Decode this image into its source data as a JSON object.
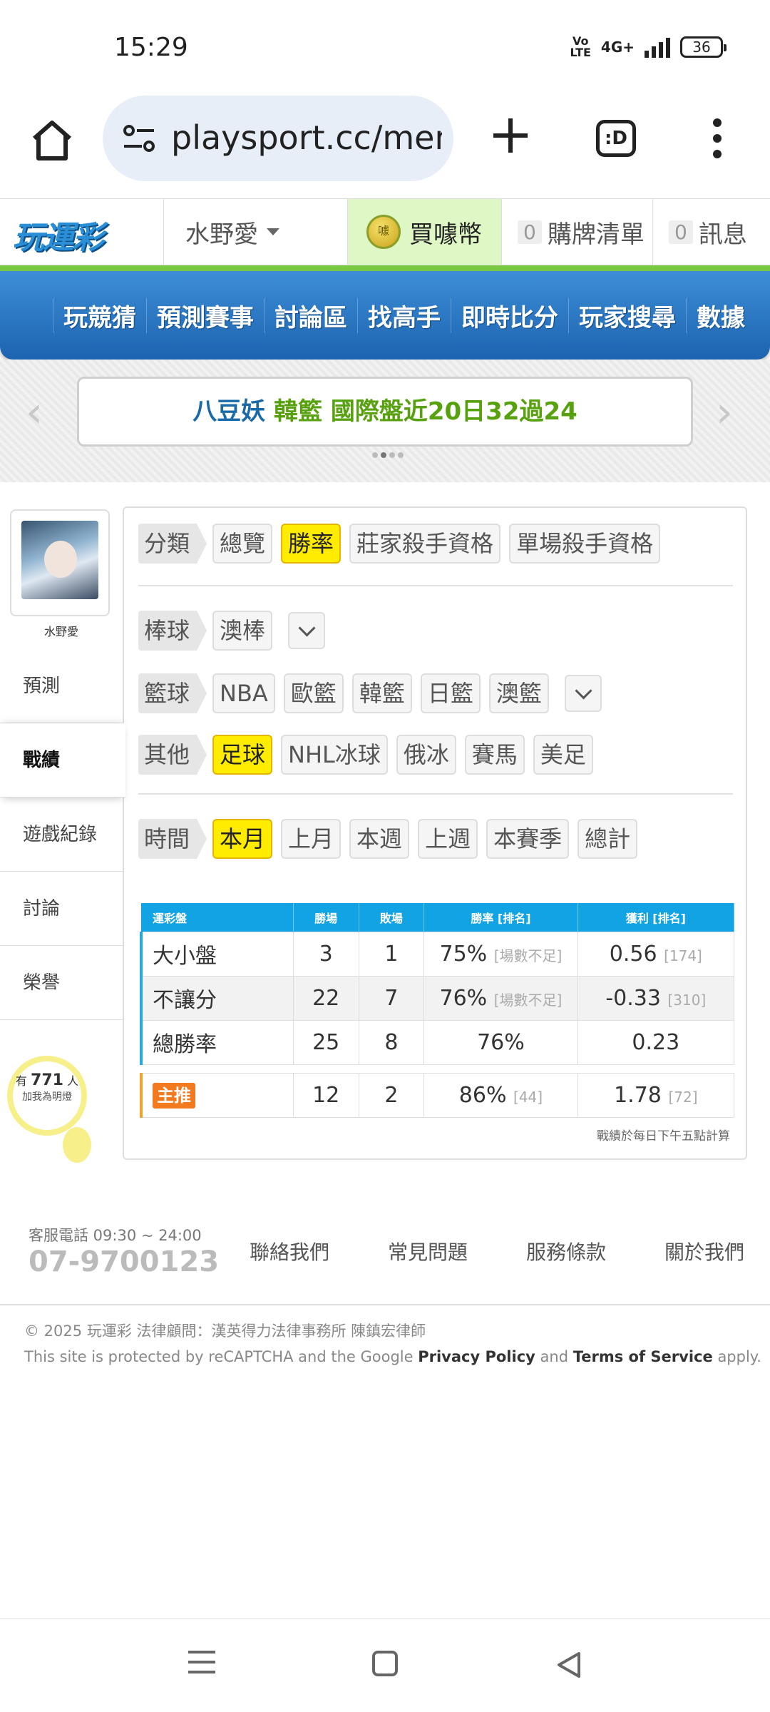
{
  "status": {
    "time": "15:29",
    "volte": "Vo LTE",
    "network": "4G+",
    "battery": "36"
  },
  "browser": {
    "url": "playsport.cc/men",
    "tabs_label": ":D"
  },
  "header": {
    "logo": "玩運彩",
    "user": "水野愛",
    "buy_coin": "買噱幣",
    "coin_mark": "噱",
    "cart_count": "0",
    "cart_label": "購牌清單",
    "msg_count": "0",
    "msg_label": "訊息"
  },
  "nav": {
    "items": [
      "玩競猜",
      "預測賽事",
      "討論區",
      "找高手",
      "即時比分",
      "玩家搜尋",
      "數據"
    ]
  },
  "marquee": {
    "part1": "八豆妖",
    "part2": "韓籃 國際盤近20日32過24"
  },
  "side": {
    "username": "水野愛",
    "menu": [
      "預測",
      "戰績",
      "遊戲紀錄",
      "討論",
      "榮譽"
    ],
    "bulb_pre": "有",
    "bulb_count": "771",
    "bulb_post": "人",
    "bulb_line2": "加我為明燈"
  },
  "filters": {
    "category_label": "分類",
    "category": [
      "總覽",
      "勝率",
      "莊家殺手資格",
      "單場殺手資格"
    ],
    "baseball_label": "棒球",
    "baseball": [
      "澳棒"
    ],
    "basketball_label": "籃球",
    "basketball": [
      "NBA",
      "歐籃",
      "韓籃",
      "日籃",
      "澳籃"
    ],
    "other_label": "其他",
    "other": [
      "足球",
      "NHL冰球",
      "俄冰",
      "賽馬",
      "美足"
    ],
    "time_label": "時間",
    "time": [
      "本月",
      "上月",
      "本週",
      "上週",
      "本賽季",
      "總計"
    ]
  },
  "table": {
    "headers": [
      "運彩盤",
      "勝場",
      "敗場",
      "勝率 [排名]",
      "獲利 [排名]"
    ],
    "rows": [
      {
        "name": "大小盤",
        "win": "3",
        "lose": "1",
        "rate": "75%",
        "rate_note": "[場數不足]",
        "profit": "0.56",
        "profit_note": "[174]"
      },
      {
        "name": "不讓分",
        "win": "22",
        "lose": "7",
        "rate": "76%",
        "rate_note": "[場數不足]",
        "profit": "-0.33",
        "profit_note": "[310]"
      },
      {
        "name": "總勝率",
        "win": "25",
        "lose": "8",
        "rate": "76%",
        "rate_note": "",
        "profit": "0.23",
        "profit_note": ""
      }
    ],
    "main": {
      "name": "主推",
      "win": "12",
      "lose": "2",
      "rate": "86%",
      "rate_note": "[44]",
      "profit": "1.78",
      "profit_note": "[72]"
    },
    "footnote": "戰績於每日下午五點計算"
  },
  "footer": {
    "service": "客服電話 09:30 ~ 24:00",
    "phone": "07-9700123",
    "links": [
      "聯絡我們",
      "常見問題",
      "服務條款",
      "關於我們"
    ],
    "copyright": "© 2025 玩運彩 法律顧問：漢英得力法律事務所 陳鎮宏律師",
    "recaptcha_pre": "This site is protected by reCAPTCHA and the Google",
    "privacy": "Privacy Policy",
    "and": "and",
    "terms": "Terms of Service",
    "apply": "apply."
  }
}
